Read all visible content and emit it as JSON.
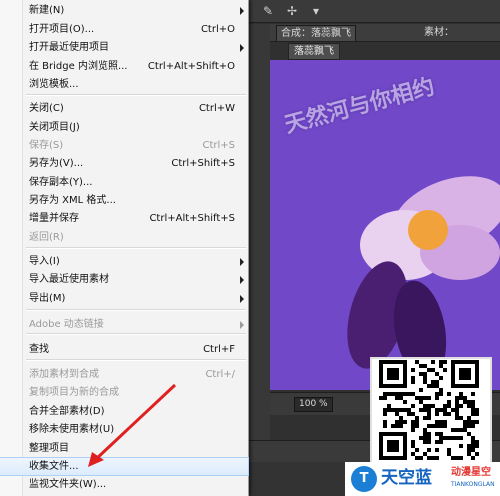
{
  "menu": {
    "items": [
      {
        "label": "新建(N)",
        "shortcut": "",
        "submenu": true,
        "disabled": false
      },
      {
        "label": "打开项目(O)...",
        "shortcut": "Ctrl+O",
        "submenu": false,
        "disabled": false
      },
      {
        "label": "打开最近使用项目",
        "shortcut": "",
        "submenu": true,
        "disabled": false
      },
      {
        "label": "在 Bridge 内浏览照...",
        "shortcut": "Ctrl+Alt+Shift+O",
        "submenu": false,
        "disabled": false
      },
      {
        "label": "浏览模板...",
        "shortcut": "",
        "submenu": false,
        "disabled": false
      },
      {
        "label": "关闭(C)",
        "shortcut": "Ctrl+W",
        "submenu": false,
        "disabled": false
      },
      {
        "label": "关闭项目(J)",
        "shortcut": "",
        "submenu": false,
        "disabled": false
      },
      {
        "label": "保存(S)",
        "shortcut": "Ctrl+S",
        "submenu": false,
        "disabled": true
      },
      {
        "label": "另存为(V)...",
        "shortcut": "Ctrl+Shift+S",
        "submenu": false,
        "disabled": false
      },
      {
        "label": "保存副本(Y)...",
        "shortcut": "",
        "submenu": false,
        "disabled": false
      },
      {
        "label": "另存为 XML 格式...",
        "shortcut": "",
        "submenu": false,
        "disabled": false
      },
      {
        "label": "增量并保存",
        "shortcut": "Ctrl+Alt+Shift+S",
        "submenu": false,
        "disabled": false
      },
      {
        "label": "返回(R)",
        "shortcut": "",
        "submenu": false,
        "disabled": true
      },
      {
        "label": "导入(I)",
        "shortcut": "",
        "submenu": true,
        "disabled": false
      },
      {
        "label": "导入最近使用素材",
        "shortcut": "",
        "submenu": true,
        "disabled": false
      },
      {
        "label": "导出(M)",
        "shortcut": "",
        "submenu": true,
        "disabled": false
      },
      {
        "label": "Adobe 动态链接",
        "shortcut": "",
        "submenu": true,
        "disabled": true
      },
      {
        "label": "查找",
        "shortcut": "Ctrl+F",
        "submenu": false,
        "disabled": false
      },
      {
        "label": "添加素材到合成",
        "shortcut": "Ctrl+/",
        "submenu": false,
        "disabled": true
      },
      {
        "label": "复制项目为新的合成",
        "shortcut": "",
        "submenu": false,
        "disabled": true
      },
      {
        "label": "合并全部素材(D)",
        "shortcut": "",
        "submenu": false,
        "disabled": false
      },
      {
        "label": "移除未使用素材(U)",
        "shortcut": "",
        "submenu": false,
        "disabled": false
      },
      {
        "label": "整理项目",
        "shortcut": "",
        "submenu": false,
        "disabled": false
      },
      {
        "label": "收集文件...",
        "shortcut": "",
        "submenu": false,
        "disabled": false,
        "highlighted": true
      },
      {
        "label": "监视文件夹(W)...",
        "shortcut": "",
        "submenu": false,
        "disabled": false
      }
    ]
  },
  "composition": {
    "tab_label": "合成：落蕊飘飞",
    "tab_other": "素材：",
    "comp_name": "落蕊飘飞",
    "zoom": "100 %"
  },
  "watermark": "天然河与你相约",
  "logo": {
    "main": "天空蓝",
    "side": "动漫星空",
    "sub": "TIANKONGLAN"
  },
  "colors": {
    "menu_bg": "#f3f3f3",
    "highlight": "#dcebfc",
    "viewer_bg": "#7148c8",
    "arrow": "#e02020"
  }
}
